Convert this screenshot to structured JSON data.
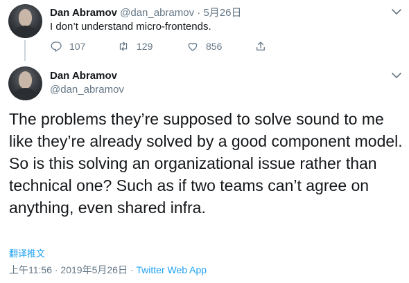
{
  "reply_tweet": {
    "author_name": "Dan Abramov",
    "author_handle": "@dan_abramov",
    "separator": "·",
    "date": "5月26日",
    "text": "I don’t understand micro-frontends.",
    "actions": {
      "reply_count": "107",
      "retweet_count": "129",
      "like_count": "856"
    },
    "icons": [
      "reply-icon",
      "retweet-icon",
      "like-icon",
      "share-icon",
      "chevron-down-icon"
    ]
  },
  "main_tweet": {
    "author_name": "Dan Abramov",
    "author_handle": "@dan_abramov",
    "text": "The problems they’re supposed to solve sound to me like they’re already solved by a good component model. So is this solving an organizational issue rather than technical one? Such as if two teams can’t agree on anything, even shared infra.",
    "translate_label": "翻译推文",
    "timestamp": "上午11:56 · 2019年5月26日 · ",
    "source": "Twitter Web App"
  },
  "colors": {
    "text": "#14171a",
    "secondary": "#657786",
    "accent": "#1da1f2",
    "thread_line": "#ccd6dd"
  }
}
